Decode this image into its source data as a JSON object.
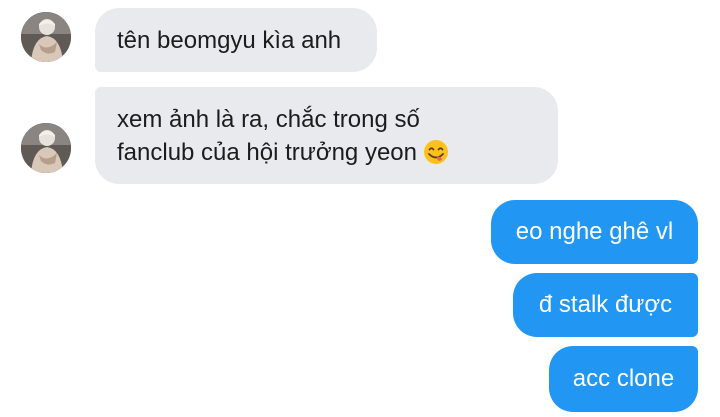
{
  "conversation": {
    "messages": [
      {
        "direction": "incoming",
        "lines": [
          "tên beomgyu kìa anh"
        ]
      },
      {
        "direction": "incoming",
        "lines": [
          "xem ảnh là ra, chắc trong số",
          "fanclub của hội trưởng yeon"
        ],
        "emoji": "face-savoring-food"
      },
      {
        "direction": "outgoing",
        "lines": [
          "eo nghe ghê vl"
        ]
      },
      {
        "direction": "outgoing",
        "lines": [
          "đ stalk được"
        ]
      },
      {
        "direction": "outgoing",
        "lines": [
          "acc clone"
        ]
      }
    ]
  },
  "colors": {
    "incoming_bubble": "#e9eaed",
    "incoming_text": "#1c1c1c",
    "outgoing_bubble": "#2196f3",
    "outgoing_text": "#ffffff"
  }
}
